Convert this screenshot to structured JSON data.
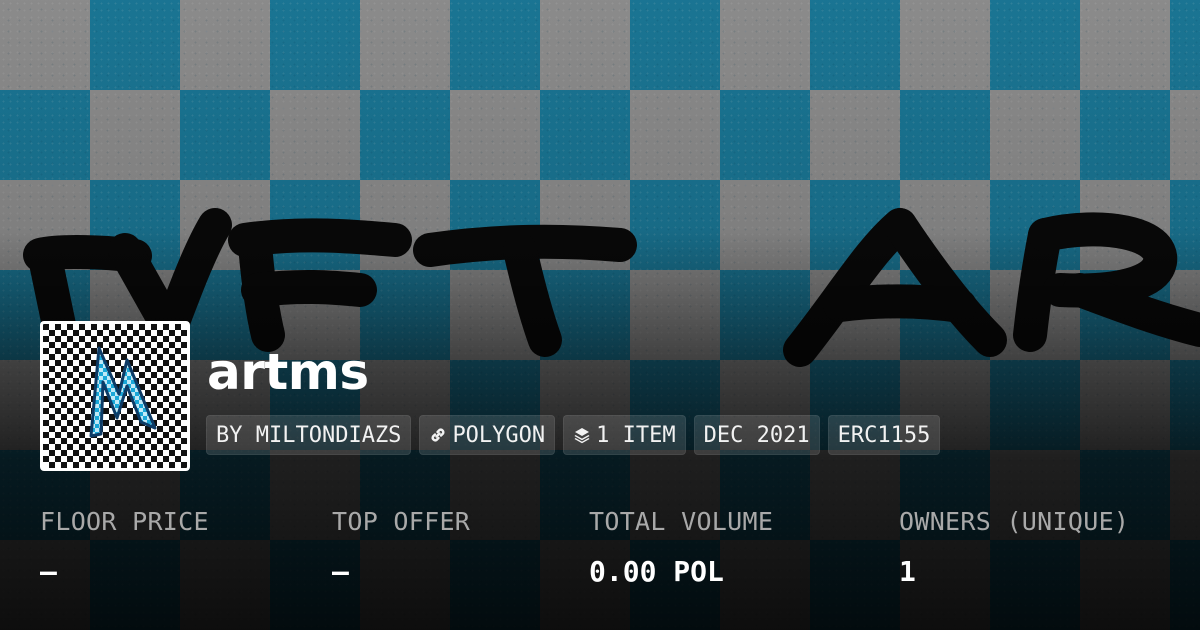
{
  "banner": {
    "art_text": "NFT AR",
    "accent_color": "#148cb4"
  },
  "collection": {
    "name": "artms",
    "avatar_icon": "lightning-checker-avatar"
  },
  "chips": [
    {
      "label": "BY MILTONDIAZS",
      "icon": null
    },
    {
      "label": "POLYGON",
      "icon": "link-icon"
    },
    {
      "label": "1 ITEM",
      "icon": "layers-icon"
    },
    {
      "label": "DEC 2021",
      "icon": null
    },
    {
      "label": "ERC1155",
      "icon": null
    }
  ],
  "stats": [
    {
      "label": "FLOOR PRICE",
      "value": "—"
    },
    {
      "label": "TOP OFFER",
      "value": "—"
    },
    {
      "label": "TOTAL VOLUME",
      "value": "0.00 POL"
    },
    {
      "label": "OWNERS (UNIQUE)",
      "value": "1"
    }
  ]
}
